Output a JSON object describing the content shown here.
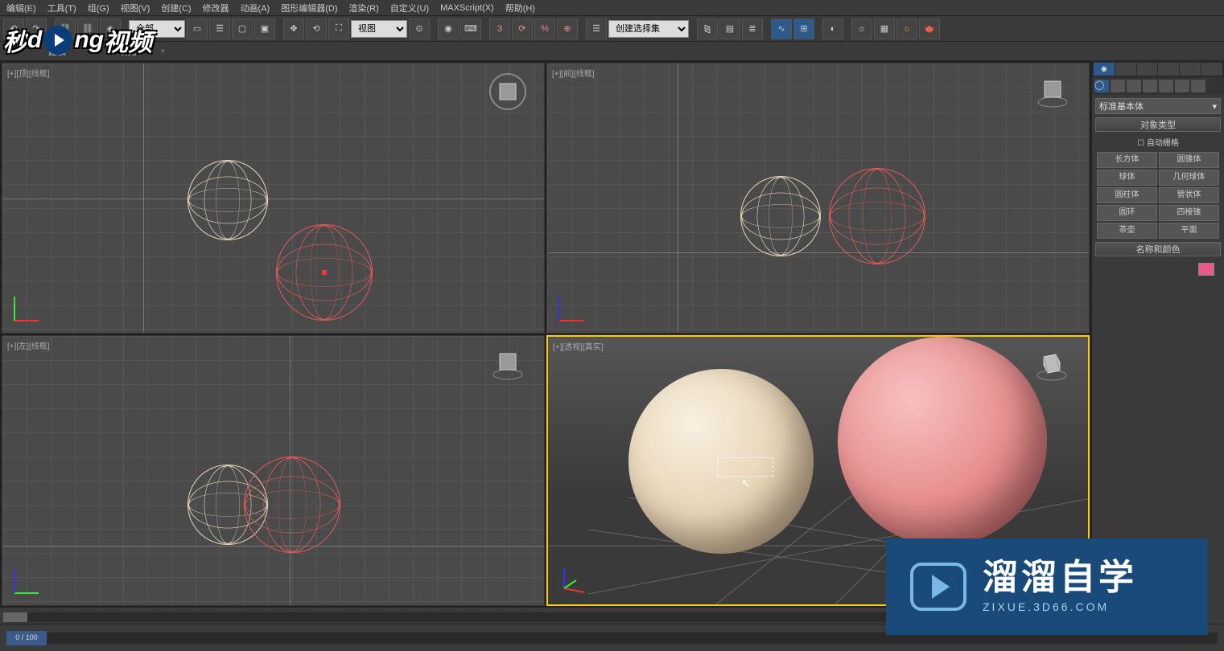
{
  "menus": [
    "编辑(E)",
    "工具(T)",
    "组(G)",
    "视图(V)",
    "创建(C)",
    "修改器",
    "动画(A)",
    "图形编辑器(D)",
    "渲染(R)",
    "自定义(U)",
    "MAXScript(X)",
    "帮助(H)"
  ],
  "toolbar": {
    "view_select": "视图",
    "create_select": "创建选择集"
  },
  "secondary_bar": {
    "label1": "建模",
    "label2": "填充"
  },
  "viewports": {
    "top_left": "[+][顶][线框]",
    "top_right": "[+][前][线框]",
    "bottom_left": "[+][左][线框]",
    "bottom_right": "[+][透视][真实]"
  },
  "right_panel": {
    "dropdown": "标准基本体",
    "rollout_object_type": "对象类型",
    "auto_grid": "自动栅格",
    "buttons": [
      [
        "长方体",
        "圆锥体"
      ],
      [
        "球体",
        "几何球体"
      ],
      [
        "圆柱体",
        "管状体"
      ],
      [
        "圆环",
        "四棱锥"
      ],
      [
        "茶壶",
        "平面"
      ]
    ],
    "rollout_name_color": "名称和颜色"
  },
  "timeline": {
    "frame": "0 / 100"
  },
  "logo_text_1": "秒",
  "logo_text_2": "ng",
  "logo_text_3": "视频",
  "brand": {
    "text": "溜溜自学",
    "url": "ZIXUE.3D66.COM"
  }
}
